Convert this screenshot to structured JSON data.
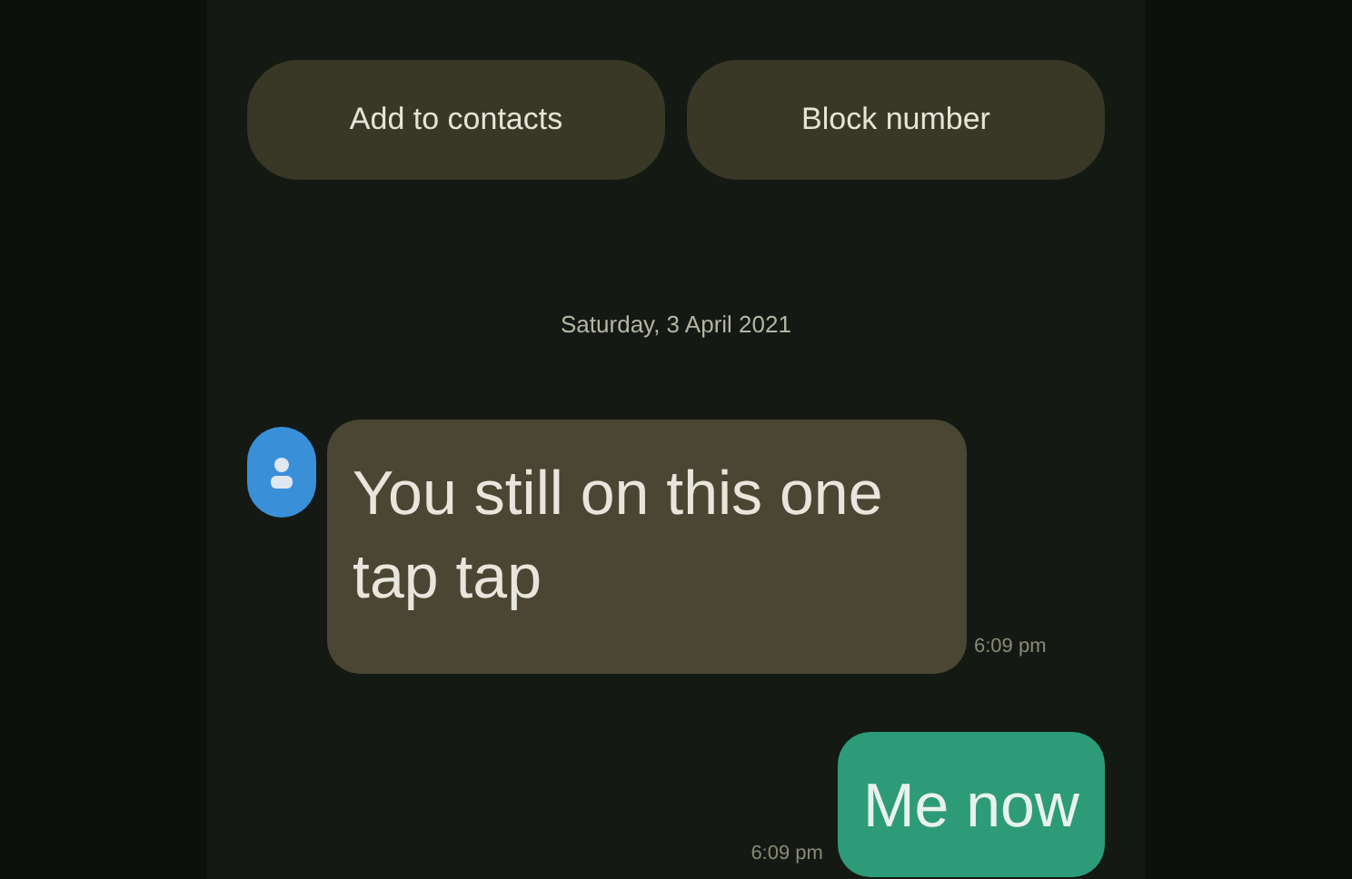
{
  "actions": [
    {
      "label": "Add to contacts"
    },
    {
      "label": "Block number"
    }
  ],
  "date": "Saturday, 3 April 2021",
  "messages": [
    {
      "kind": "incoming",
      "text": "You still on this one tap tap",
      "time": "6:09 pm"
    },
    {
      "kind": "outgoing",
      "text": "Me now",
      "time": "6:09 pm"
    }
  ]
}
